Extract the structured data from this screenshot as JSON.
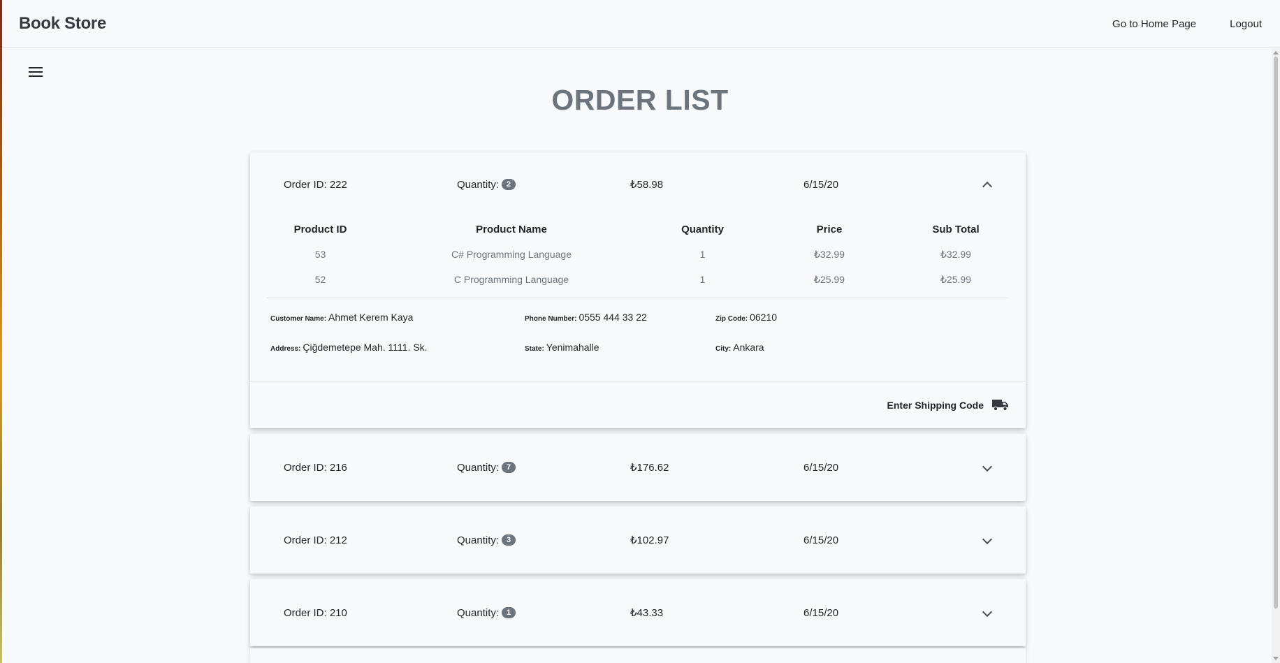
{
  "navbar": {
    "brand": "Book Store",
    "home_link": "Go to Home Page",
    "logout_link": "Logout"
  },
  "menu": {
    "icon": "hamburger-menu-icon"
  },
  "page": {
    "title": "ORDER LIST"
  },
  "orders": [
    {
      "order_id_label": "Order ID: 222",
      "quantity_label": "Quantity:",
      "quantity": "2",
      "total": "₺58.98",
      "date": "6/15/20",
      "expanded": true,
      "items_headers": [
        "Product ID",
        "Product Name",
        "Quantity",
        "Price",
        "Sub Total"
      ],
      "items": [
        {
          "product_id": "53",
          "product_name": "C# Programming Language",
          "quantity": "1",
          "price": "₺32.99",
          "sub_total": "₺32.99"
        },
        {
          "product_id": "52",
          "product_name": "C Programming Language",
          "quantity": "1",
          "price": "₺25.99",
          "sub_total": "₺25.99"
        }
      ],
      "customer": {
        "name_label": "Customer Name:",
        "name": "Ahmet Kerem Kaya",
        "phone_label": "Phone Number:",
        "phone": "0555 444 33 22",
        "zip_label": "Zip Code:",
        "zip": "06210",
        "address_label": "Address:",
        "address": "Çiğdemetepe Mah. 1111. Sk.",
        "state_label": "State:",
        "state": "Yenimahalle",
        "city_label": "City:",
        "city": "Ankara"
      },
      "shipping_button": "Enter Shipping Code",
      "shipping_icon": "truck-icon"
    },
    {
      "order_id_label": "Order ID: 216",
      "quantity_label": "Quantity:",
      "quantity": "7",
      "total": "₺176.62",
      "date": "6/15/20",
      "expanded": false
    },
    {
      "order_id_label": "Order ID: 212",
      "quantity_label": "Quantity:",
      "quantity": "3",
      "total": "₺102.97",
      "date": "6/15/20",
      "expanded": false
    },
    {
      "order_id_label": "Order ID: 210",
      "quantity_label": "Quantity:",
      "quantity": "1",
      "total": "₺43.33",
      "date": "6/15/20",
      "expanded": false
    }
  ]
}
